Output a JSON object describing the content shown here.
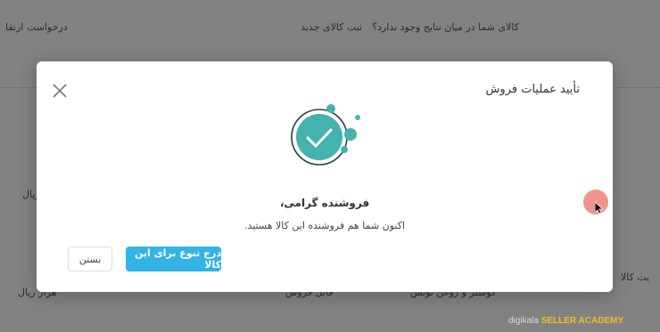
{
  "background": {
    "header_right": "کالای شما در میان نتایج وجود ندارد؟",
    "header_link": "ثبت کالای جدید",
    "header_left": "درخواست ارتقا",
    "left_label": "ریال",
    "bottom_left": "هزار ریال",
    "bottom_mid1": "قابل فروش",
    "bottom_mid2": "کوشلر و روغن توتس",
    "bottom_right": "یت کالا"
  },
  "modal": {
    "title": "تأیید عملیات فروش",
    "greeting": "فروشنده گرامی،",
    "message": "اکنون شما هم فروشنده این کالا هستید.",
    "primary_button": "درج تنوع برای این کالا",
    "secondary_button": "بستن"
  },
  "icons": {
    "close": "close-icon",
    "success": "check-circle-icon"
  },
  "colors": {
    "accent_teal": "#45b3ad",
    "primary_blue": "#34b3e5"
  },
  "watermark": {
    "brand": "digikala",
    "academy": "SELLER ACADEMY"
  }
}
